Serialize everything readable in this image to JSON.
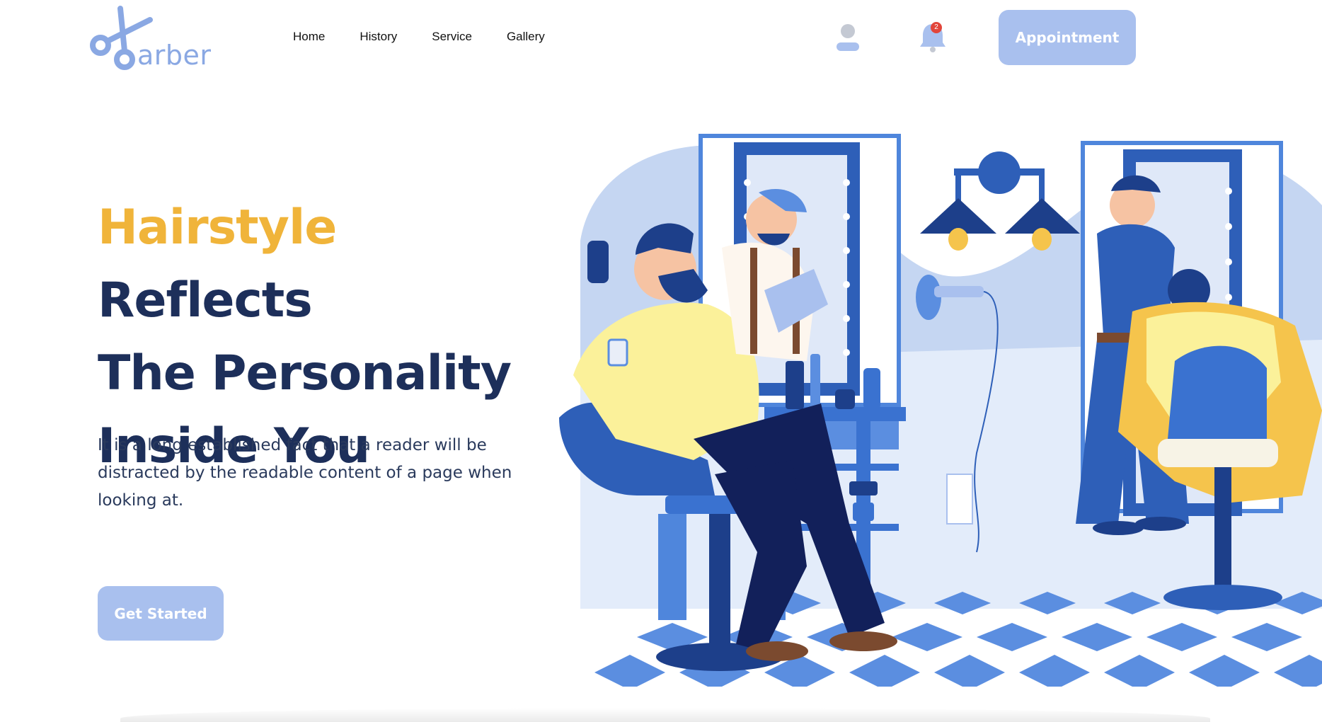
{
  "header": {
    "logo_text": "arber",
    "nav": [
      "Home",
      "History",
      "Service",
      "Gallery"
    ],
    "notification_count": "2",
    "appointment_label": "Appointment"
  },
  "hero": {
    "headline_accent": "Hairstyle",
    "headline_rest_1": " Reflects",
    "headline_line_2": "The Personality",
    "headline_line_3": "Inside You",
    "description": "It is a long established fact that a reader will be distracted by the readable content of a page when looking at.",
    "cta_label": "Get Started"
  },
  "colors": {
    "accent_yellow": "#f0b43a",
    "heading_navy": "#1d2f5a",
    "button_blue": "#a9c0ee",
    "logo_blue": "#8aa8e3"
  },
  "icons": [
    "scissors-icon",
    "user-icon",
    "bell-icon"
  ]
}
